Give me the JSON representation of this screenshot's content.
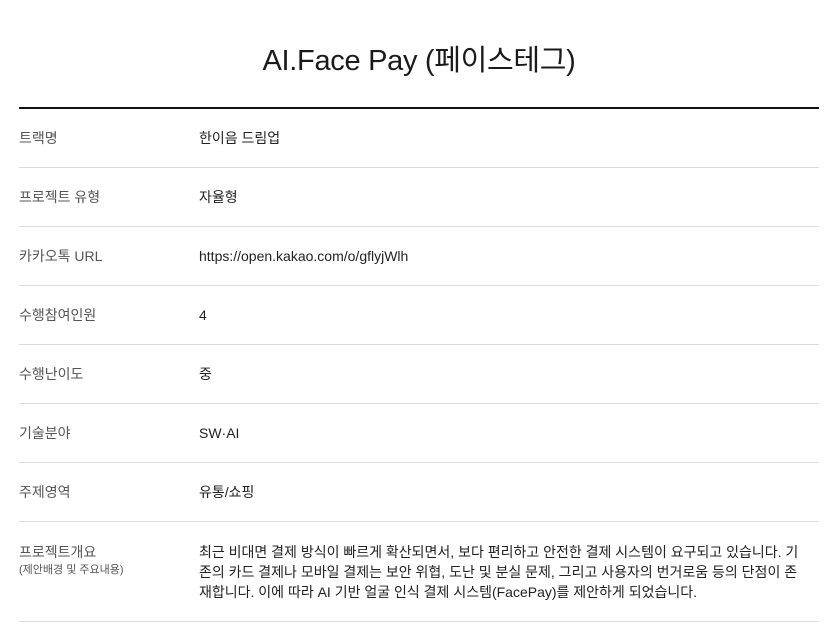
{
  "page": {
    "title": "AI.Face Pay (페이스테그)"
  },
  "details": {
    "rows": [
      {
        "label": "트랙명",
        "value": "한이음 드림업"
      },
      {
        "label": "프로젝트 유형",
        "value": "자율형"
      },
      {
        "label": "카카오톡 URL",
        "value": "https://open.kakao.com/o/gflyjWlh"
      },
      {
        "label": "수행참여인원",
        "value": "4"
      },
      {
        "label": "수행난이도",
        "value": "중"
      },
      {
        "label": "기술분야",
        "value": "SW·AI"
      },
      {
        "label": "주제영역",
        "value": "유통/쇼핑"
      }
    ],
    "overview": {
      "label": "프로젝트개요",
      "sublabel": "(제안배경 및 주요내용)",
      "value": "최근 비대면 결제 방식이 빠르게 확산되면서, 보다 편리하고 안전한 결제 시스템이 요구되고 있습니다. 기존의 카드 결제나 모바일 결제는 보안 위협, 도난 및 분실 문제, 그리고 사용자의 번거로움 등의 단점이 존재합니다. 이에 따라 AI 기반 얼굴 인식 결제 시스템(FacePay)를 제안하게 되었습니다."
    }
  }
}
